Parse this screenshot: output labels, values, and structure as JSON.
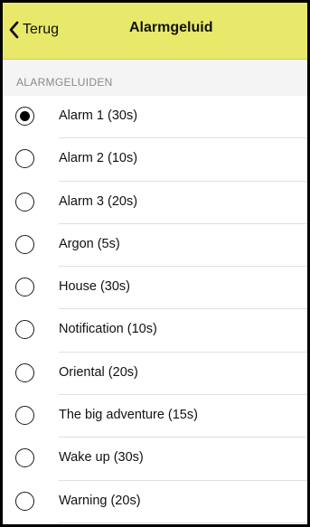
{
  "navbar": {
    "back_label": "Terug",
    "title": "Alarmgeluid",
    "color": "#e8e86a"
  },
  "section": {
    "header": "ALARMGELUIDEN"
  },
  "sounds": [
    {
      "label": "Alarm 1 (30s)",
      "selected": true
    },
    {
      "label": "Alarm 2 (10s)",
      "selected": false
    },
    {
      "label": "Alarm 3 (20s)",
      "selected": false
    },
    {
      "label": "Argon (5s)",
      "selected": false
    },
    {
      "label": "House (30s)",
      "selected": false
    },
    {
      "label": "Notification (10s)",
      "selected": false
    },
    {
      "label": "Oriental (20s)",
      "selected": false
    },
    {
      "label": "The big adventure (15s)",
      "selected": false
    },
    {
      "label": "Wake up (30s)",
      "selected": false
    },
    {
      "label": "Warning (20s)",
      "selected": false
    }
  ]
}
